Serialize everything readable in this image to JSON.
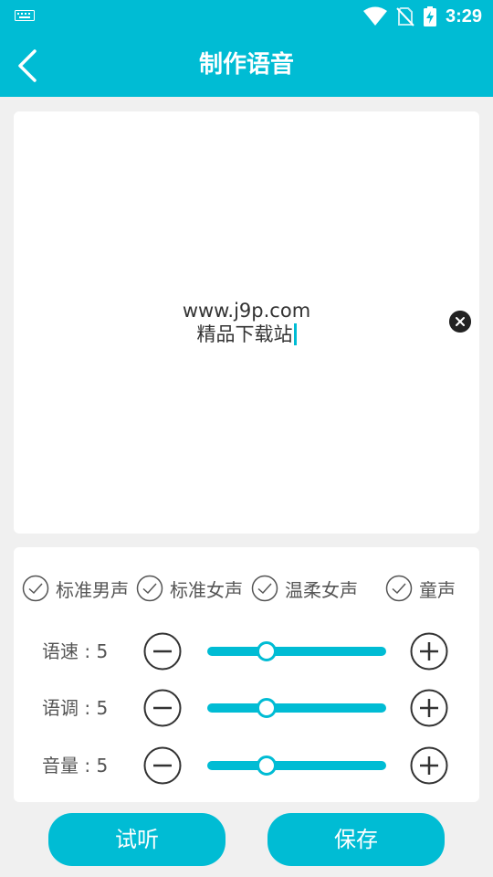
{
  "status_bar": {
    "time": "3:29"
  },
  "header": {
    "title": "制作语音"
  },
  "editor": {
    "line1": "www.j9p.com",
    "line2": "精品下载站"
  },
  "voice_options": [
    {
      "label": "标准男声"
    },
    {
      "label": "标准女声"
    },
    {
      "label": "温柔女声"
    },
    {
      "label": "童声"
    }
  ],
  "controls": [
    {
      "label": "语速 : 5",
      "value": 5,
      "min": 0,
      "max": 15
    },
    {
      "label": "语调 : 5",
      "value": 5,
      "min": 0,
      "max": 15
    },
    {
      "label": "音量 : 5",
      "value": 5,
      "min": 0,
      "max": 15
    }
  ],
  "buttons": {
    "listen": "试听",
    "save": "保存"
  },
  "colors": {
    "accent": "#00bcd4",
    "background": "#f0f0f0",
    "card": "#ffffff"
  }
}
